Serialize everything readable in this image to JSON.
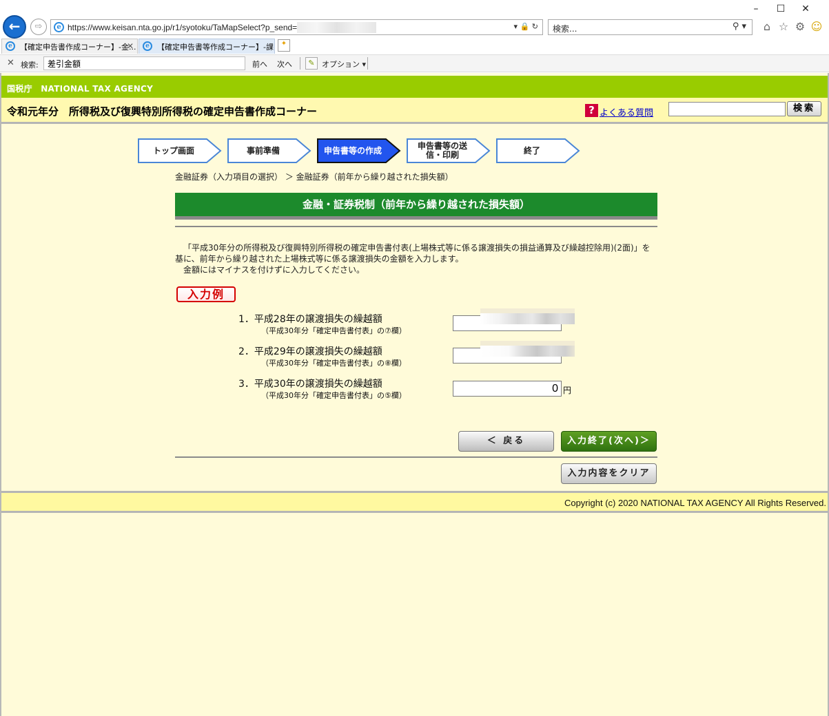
{
  "browser": {
    "url": "https://www.keisan.nta.go.jp/r1/syotoku/TaMapSelect?p_send=",
    "search_placeholder": "検索...",
    "tabs": [
      {
        "label": "【確定申告書作成コーナー】-金..."
      },
      {
        "label": "【確定申告書等作成コーナー】-課..."
      }
    ],
    "findbar": {
      "label": "検索:",
      "query": "差引金額",
      "prev": "前へ",
      "next": "次へ",
      "options": "オプション ▾"
    }
  },
  "header": {
    "agency": "国税庁　NATIONAL TAX AGENCY",
    "title": "令和元年分　所得税及び復興特別所得税の確定申告書作成コーナー",
    "faq_link": "よくある質問",
    "search_button": "検索"
  },
  "steps": [
    {
      "label": "トップ画面",
      "state": "done"
    },
    {
      "label": "事前準備",
      "state": "done"
    },
    {
      "label": "申告書等の作成",
      "state": "current"
    },
    {
      "label": "申告書等の送信・印刷",
      "state": "todo"
    },
    {
      "label": "終了",
      "state": "todo"
    }
  ],
  "breadcrumb": "金融証券（入力項目の選択） ＞ 金融証券（前年から繰り越された損失額）",
  "section_title": "金融・証券税制（前年から繰り越された損失額）",
  "description": {
    "line1": "「平成30年分の所得税及び復興特別所得税の確定申告書付表(上場株式等に係る譲渡損失の損益通算及び繰越控除用)(2面)」を基に、前年から繰り越された上場株式等に係る譲渡損失の金額を入力します。",
    "line2": "金額にはマイナスを付けずに入力してください。"
  },
  "example_button": "入力例",
  "items": [
    {
      "label": "1．平成28年の譲渡損失の繰越額",
      "sub": "（平成30年分「確定申告書付表」の⑦欄）",
      "value": ""
    },
    {
      "label": "2．平成29年の譲渡損失の繰越額",
      "sub": "（平成30年分「確定申告書付表」の⑧欄）",
      "value": ""
    },
    {
      "label": "3．平成30年の譲渡損失の繰越額",
      "sub": "（平成30年分「確定申告書付表」の⑤欄）",
      "value": "0",
      "unit": "円"
    }
  ],
  "buttons": {
    "back": "＜ 戻る",
    "finish": "入力終了(次へ)＞",
    "clear": "入力内容をクリア"
  },
  "footer": {
    "copyright": "Copyright (c) 2020 NATIONAL TAX AGENCY All Rights Reserved."
  },
  "colors": {
    "agency_bar": "#99cc00",
    "section_head": "#1c8a2c",
    "step_current": "#2255ee",
    "page_bg": "#fffbd9"
  }
}
